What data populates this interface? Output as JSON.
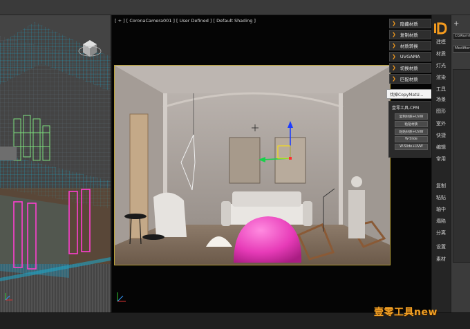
{
  "viewport": {
    "label": "[ + ] [ CoronaCamera001 ] [ User Defined ] [ Default Shading ]"
  },
  "plugin_menu": {
    "items": [
      {
        "label": "隐藏材质",
        "icon": "chevron-right-icon"
      },
      {
        "label": "复制材质",
        "icon": "chevron-right-icon"
      },
      {
        "label": "材质转换",
        "icon": "chevron-right-icon"
      },
      {
        "label": "UVGAMA",
        "icon": "chevron-right-icon"
      },
      {
        "label": "切换材质",
        "icon": "chevron-right-icon"
      },
      {
        "label": "匹配材质",
        "icon": "chevron-right-icon"
      }
    ],
    "accent": "#f39a1e"
  },
  "tooltip": {
    "text": "伐掉CopyMatU..."
  },
  "cpm_panel": {
    "title": "壹零工具-CPM",
    "buttons": [
      "复制材质+UVW",
      "粘贴材质",
      "粘贴材质+UVW",
      "W-Slide",
      "W-Slide+UVW"
    ]
  },
  "right_strip": {
    "labels_top": [
      "建模",
      "材质",
      "灯光",
      "渲染",
      "工具",
      "场景",
      "图形",
      "室外",
      "快捷",
      "编辑",
      "常用"
    ],
    "labels_bottom": [
      "复制",
      "粘贴",
      "轴中",
      "塌陷",
      "分离",
      "设置",
      "素材"
    ]
  },
  "command_panel": {
    "name_field": "CGRuml",
    "modifier_field": "Modifier L"
  },
  "watermark": "壹零工具new"
}
